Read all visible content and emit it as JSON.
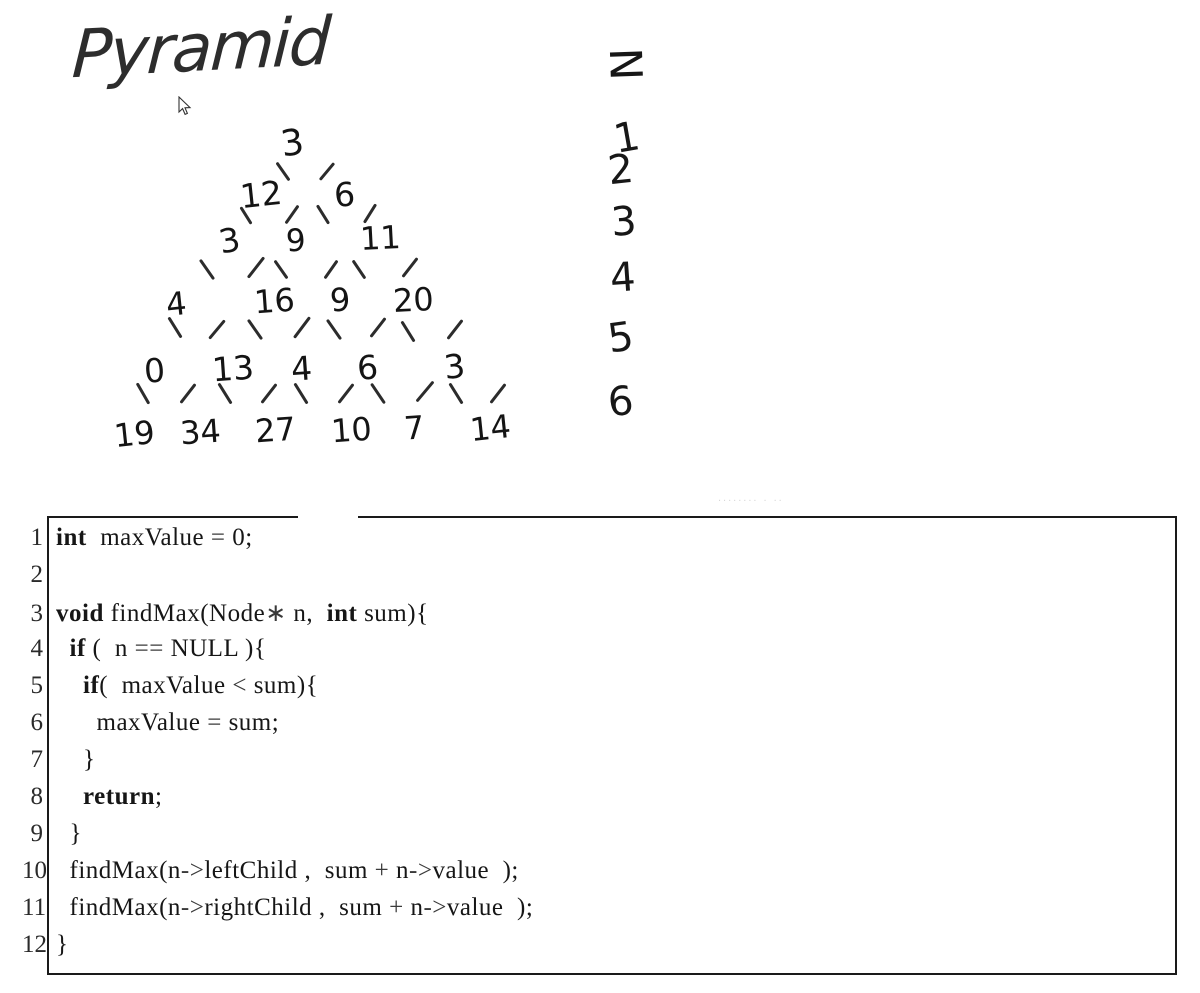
{
  "sketch": {
    "title": "Pyramid",
    "cursor_icon": "mouse-pointer-icon",
    "pyramid": {
      "rows": [
        [
          "3"
        ],
        [
          "12",
          "6"
        ],
        [
          "3",
          "9",
          "11"
        ],
        [
          "4",
          "16",
          "9",
          "20"
        ],
        [
          "0",
          "13",
          "4",
          "6",
          "3"
        ],
        [
          "19",
          "34",
          "27",
          "10",
          "7",
          "14"
        ]
      ]
    },
    "level_column": {
      "header": "N",
      "levels": [
        "1",
        "2",
        "3",
        "4",
        "5",
        "6"
      ]
    },
    "scan_artifact": "........ . .."
  },
  "code": {
    "language": "C++",
    "lines": [
      {
        "n": "1",
        "indent": 0,
        "segments": [
          {
            "t": "int",
            "bold": true
          },
          {
            "t": "  maxValue "
          },
          {
            "t": "=",
            "op": true
          },
          {
            "t": " 0;"
          }
        ]
      },
      {
        "n": "2",
        "indent": 0,
        "segments": []
      },
      {
        "n": "3",
        "indent": 0,
        "segments": [
          {
            "t": "void",
            "bold": true
          },
          {
            "t": " findMax(Node"
          },
          {
            "t": "∗",
            "op": true
          },
          {
            "t": " n,  "
          },
          {
            "t": "int",
            "bold": true
          },
          {
            "t": " sum){"
          }
        ]
      },
      {
        "n": "4",
        "indent": 1,
        "segments": [
          {
            "t": "if",
            "bold": true
          },
          {
            "t": " (  n "
          },
          {
            "t": "==",
            "op": true
          },
          {
            "t": " NULL ){"
          }
        ]
      },
      {
        "n": "5",
        "indent": 2,
        "segments": [
          {
            "t": "if",
            "bold": true
          },
          {
            "t": "(  maxValue "
          },
          {
            "t": "<",
            "op": true
          },
          {
            "t": " sum){"
          }
        ]
      },
      {
        "n": "6",
        "indent": 3,
        "segments": [
          {
            "t": "maxValue "
          },
          {
            "t": "=",
            "op": true
          },
          {
            "t": " sum;"
          }
        ]
      },
      {
        "n": "7",
        "indent": 2,
        "segments": [
          {
            "t": "}"
          }
        ]
      },
      {
        "n": "8",
        "indent": 2,
        "segments": [
          {
            "t": "return",
            "bold": true
          },
          {
            "t": ";"
          }
        ]
      },
      {
        "n": "9",
        "indent": 1,
        "segments": [
          {
            "t": "}"
          }
        ]
      },
      {
        "n": "10",
        "indent": 1,
        "segments": [
          {
            "t": "findMax(n"
          },
          {
            "t": "->",
            "op": true
          },
          {
            "t": "leftChild ,  sum "
          },
          {
            "t": "+",
            "op": true
          },
          {
            "t": " n"
          },
          {
            "t": "->",
            "op": true
          },
          {
            "t": "value  );"
          }
        ]
      },
      {
        "n": "11",
        "indent": 1,
        "segments": [
          {
            "t": "findMax(n"
          },
          {
            "t": "->",
            "op": true
          },
          {
            "t": "rightChild ,  sum "
          },
          {
            "t": "+",
            "op": true
          },
          {
            "t": " n"
          },
          {
            "t": "->",
            "op": true
          },
          {
            "t": "value  );"
          }
        ]
      },
      {
        "n": "12",
        "indent": 0,
        "segments": [
          {
            "t": "}"
          }
        ]
      }
    ]
  },
  "colors": {
    "ink": "#1a1a1a",
    "border": "#1a1a1a",
    "background": "#ffffff",
    "operator": "#3a3a3a"
  }
}
